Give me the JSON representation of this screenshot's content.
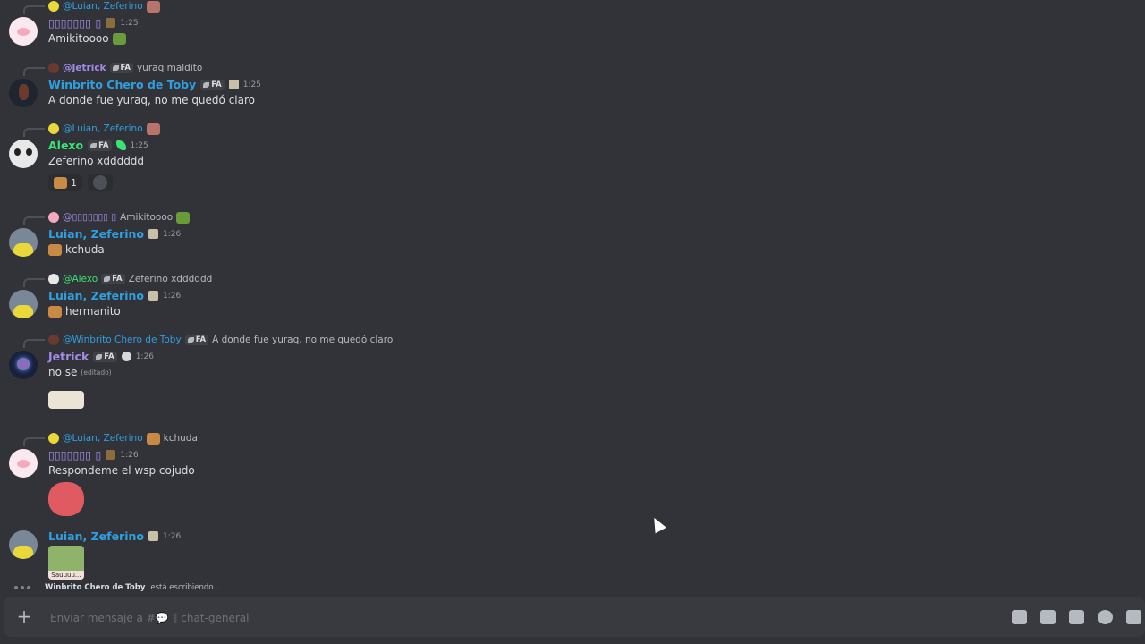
{
  "messages": [
    {
      "reply": {
        "user": "@Luian, Zeferino",
        "text": ""
      },
      "author": "▯▯▯▯▯▯▯ ▯",
      "author_color": "#a48be8",
      "time": "1:25",
      "text": "Amikitoooo",
      "avatar": "pink-avatar"
    },
    {
      "reply": {
        "user": "@Jetrick",
        "tag": "FA",
        "text": "yuraq maldito"
      },
      "author": "Winbrito Chero de Toby",
      "author_color": "#2f9fe0",
      "tag": "FA",
      "time": "1:25",
      "text": "A donde fue yuraq, no me quedó claro",
      "avatar": "dark-avatar"
    },
    {
      "reply": {
        "user": "@Luian, Zeferino",
        "text": ""
      },
      "author": "Alexo",
      "author_color": "#3ae374",
      "tag": "FA",
      "time": "1:25",
      "text": "Zeferino xdddddd",
      "avatar": "panda-avatar",
      "reaction_count": "1"
    },
    {
      "reply": {
        "user": "@▯▯▯▯▯▯▯ ▯",
        "text": "Amikitoooo"
      },
      "author": "Luian, Zeferino",
      "author_color": "#2f9fe0",
      "time": "1:26",
      "text": "kchuda",
      "avatar": "yellow-avatar"
    },
    {
      "reply": {
        "user": "@Alexo",
        "tag": "FA",
        "text": "Zeferino xdddddd"
      },
      "author": "Luian, Zeferino",
      "author_color": "#2f9fe0",
      "time": "1:26",
      "text": "hermanito",
      "avatar": "yellow-avatar"
    },
    {
      "reply": {
        "user": "@Winbrito Chero de Toby",
        "tag": "FA",
        "text": "A donde fue yuraq, no me quedó claro"
      },
      "author": "Jetrick",
      "author_color": "#a48be8",
      "tag": "FA",
      "time": "1:26",
      "text": "no se",
      "edited": "(editado)",
      "avatar": "space-avatar"
    },
    {
      "reply": {
        "user": "@Luian, Zeferino",
        "text": "kchuda"
      },
      "author": "▯▯▯▯▯▯▯ ▯",
      "author_color": "#a48be8",
      "time": "1:26",
      "text": "Respondeme el wsp cojudo",
      "avatar": "pink-avatar"
    },
    {
      "author": "Luian, Zeferino",
      "author_color": "#2f9fe0",
      "time": "1:26",
      "sticker_caption": "Sauuuu...",
      "avatar": "yellow-avatar"
    }
  ],
  "typing": {
    "user": "Winbrito Chero de Toby",
    "text": "está escribiendo..."
  },
  "composer": {
    "placeholder": "Enviar mensaje a #💬 ⟧ chat-general"
  },
  "icons": [
    "add-icon",
    "gift-icon",
    "gif-icon",
    "sticker-icon",
    "emoji-icon",
    "apps-icon"
  ]
}
